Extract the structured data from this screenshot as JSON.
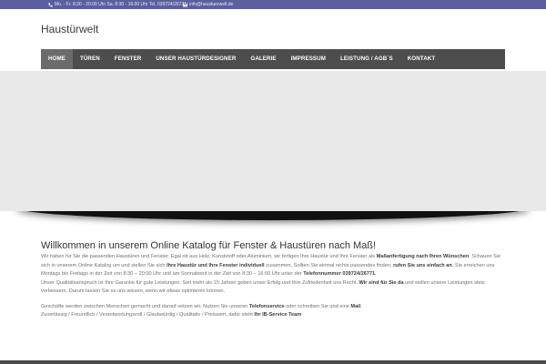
{
  "topbar": {
    "phone_text": "Mo. - Fr. 8:30 - 20:00 Uhr Sa. 8:30 - 16:00 Uhr Tel. 039724/26771",
    "email_text": "info@haustuerwelt.de",
    "bg_color": "#5b5f9e"
  },
  "header": {
    "logo_text": "Haustürwelt"
  },
  "nav": {
    "items": [
      {
        "label": "HOME",
        "active": true
      },
      {
        "label": "TÜREN",
        "active": false
      },
      {
        "label": "FENSTER",
        "active": false
      },
      {
        "label": "UNSER HAUSTÜRDESIGNER",
        "active": false
      },
      {
        "label": "GALERIE",
        "active": false
      },
      {
        "label": "IMPRESSUM",
        "active": false
      },
      {
        "label": "LEISTUNG / AGB´S",
        "active": false
      },
      {
        "label": "KONTAKT",
        "active": false
      }
    ]
  },
  "content": {
    "heading": "Willkommen in unserem Online Katalog für Fenster & Haustüren nach Maß!",
    "p1": {
      "t1": "Wir haben für Sie die passenden Haustüren und Fenster. Egal ob aus Holz, Kunststoff oder Aluminium, wir fertigen Ihre Haustür und Ihre Fenster als ",
      "b1": "Maßanfertigung nach Ihren Wünschen",
      "t2": ". Schauen Sie sich in unserem Online Katalog um und stellen Sie sich ",
      "b2": "Ihre Haustür und Ihre Fenster individuell",
      "t3": " zusammen. Sollten Sie einmal nichts passendes finden, ",
      "b3": "rufen Sie uns einfach an",
      "t4": ". Sie erreichen uns Montags bis Freitags in der Zeit von 8:30 – 20:00 Uhr und am Sonnabend in der Zeit von 8:30 – 16:00 Uhr unter der ",
      "b4": "Telefonnummer 039724/26771",
      "t5": "."
    },
    "p2": {
      "t1": "Unser Qualitätsanspruch ist Ihre Garantie für gute Leistungen. Seit mehr als 15 Jahren geben unser Erfolg und Ihre Zufriedenheit uns Recht. ",
      "b1": "Wir sind für Sie da",
      "t2": " und wollen unsere Leistungen stets verbessern. Darum lassen Sie es uns wissen, wenn wir etwas optimieren können."
    },
    "p3": {
      "t1": "Geschäfte werden zwischen Menschen gemacht und darauf setzen wir. Nutzen Sie unseren ",
      "b1": "Telefonservice",
      "t2": " oder schreiben Sie und eine ",
      "b2": "Mail",
      "t3": "."
    },
    "p4": {
      "t1": "Zuverlässig / Freundlich / Verantwortungsvoll / Glaubwürdig / Qualitativ / Preiswert, dafür steht ",
      "b1": "Ihr IB-Service Team"
    }
  }
}
